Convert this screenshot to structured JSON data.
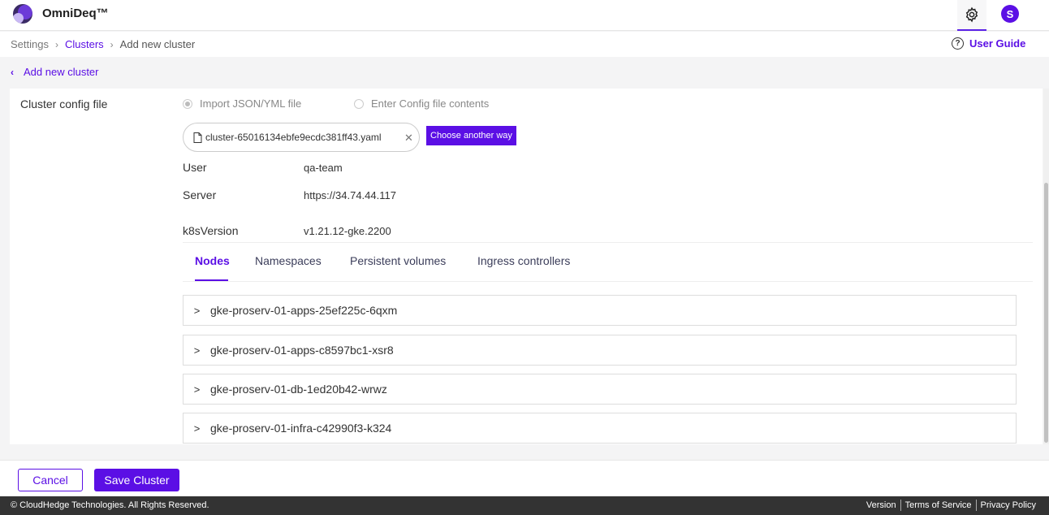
{
  "app": {
    "brand": "OmniDeq™"
  },
  "header": {
    "gear_icon": "gear-icon",
    "avatar_initial": "S"
  },
  "breadcrumb": {
    "items": [
      "Settings",
      "Clusters",
      "Add new cluster"
    ]
  },
  "user_guide": {
    "label": "User Guide",
    "icon": "help-circle-icon"
  },
  "back": {
    "label": "Add new cluster"
  },
  "config": {
    "label": "Cluster config file",
    "option_import": "Import JSON/YML file",
    "option_enter": "Enter Config file contents",
    "selected_option": "Import JSON/YML file",
    "file_name": "cluster-65016134ebfe9ecdc381ff43.yaml",
    "choose_another": "Choose another way"
  },
  "details": {
    "user_label": "User",
    "user_value": "qa-team",
    "server_label": "Server",
    "server_value": "https://34.74.44.117",
    "version_label": "k8sVersion",
    "version_value": "v1.21.12-gke.2200"
  },
  "tabs": [
    "Nodes",
    "Namespaces",
    "Persistent volumes",
    "Ingress controllers"
  ],
  "active_tab": "Nodes",
  "nodes": [
    "gke-proserv-01-apps-25ef225c-6qxm",
    "gke-proserv-01-apps-c8597bc1-xsr8",
    "gke-proserv-01-db-1ed20b42-wrwz",
    "gke-proserv-01-infra-c42990f3-k324"
  ],
  "actions": {
    "cancel": "Cancel",
    "save": "Save Cluster"
  },
  "footer": {
    "copyright": "© CloudHedge Technologies. All Rights Reserved.",
    "links": [
      "Version",
      "Terms of Service",
      "Privacy Policy"
    ]
  },
  "colors": {
    "accent": "#5b0fe5",
    "footer_bg": "#333333"
  }
}
